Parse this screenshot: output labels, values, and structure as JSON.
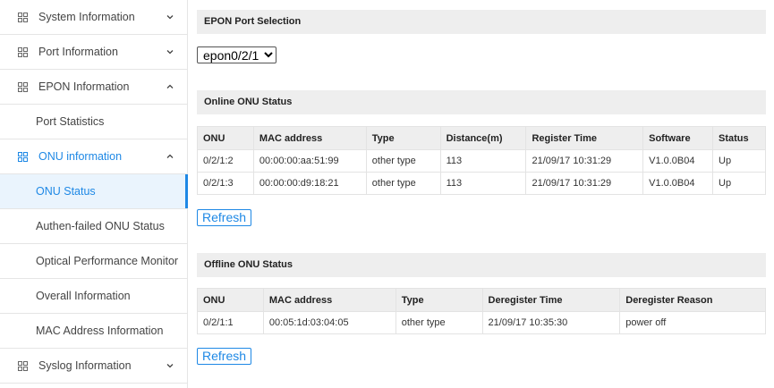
{
  "sidebar": {
    "items": [
      {
        "label": "System Information",
        "icon": "grid-icon",
        "chevron": "down"
      },
      {
        "label": "Port Information",
        "icon": "grid-icon",
        "chevron": "down"
      },
      {
        "label": "EPON Information",
        "icon": "grid-icon",
        "chevron": "up"
      },
      {
        "label": "Port Statistics"
      },
      {
        "label": "ONU information",
        "icon": "grid-icon",
        "chevron": "up"
      },
      {
        "label": "ONU Status"
      },
      {
        "label": "Authen-failed ONU Status"
      },
      {
        "label": "Optical Performance Monitor"
      },
      {
        "label": "Overall Information"
      },
      {
        "label": "MAC Address Information"
      },
      {
        "label": "Syslog Information",
        "icon": "grid-icon",
        "chevron": "down"
      }
    ]
  },
  "main": {
    "port_section_title": "EPON Port Selection",
    "port_select_value": "epon0/2/1",
    "online_title": "Online ONU Status",
    "online_headers": [
      "ONU",
      "MAC address",
      "Type",
      "Distance(m)",
      "Register Time",
      "Software",
      "Status"
    ],
    "online_rows": [
      [
        "0/2/1:2",
        "00:00:00:aa:51:99",
        "other type",
        "113",
        "21/09/17 10:31:29",
        "V1.0.0B04",
        "Up"
      ],
      [
        "0/2/1:3",
        "00:00:00:d9:18:21",
        "other type",
        "113",
        "21/09/17 10:31:29",
        "V1.0.0B04",
        "Up"
      ]
    ],
    "refresh_label": "Refresh",
    "offline_title": "Offline ONU Status",
    "offline_headers": [
      "ONU",
      "MAC address",
      "Type",
      "Deregister Time",
      "Deregister Reason"
    ],
    "offline_rows": [
      [
        "0/2/1:1",
        "00:05:1d:03:04:05",
        "other type",
        "21/09/17 10:35:30",
        "power off"
      ]
    ],
    "refresh2_label": "Refresh"
  },
  "colors": {
    "accent": "#1e88e5",
    "header_bg": "#eeeeee",
    "selected_bg": "#eaf4fd"
  }
}
